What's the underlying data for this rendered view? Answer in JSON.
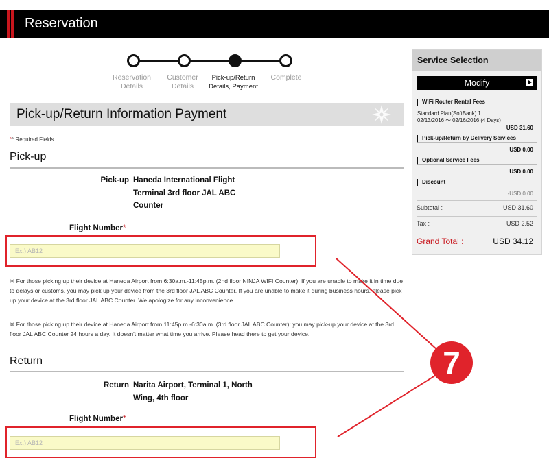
{
  "header": {
    "title": "Reservation"
  },
  "steps": [
    {
      "label_line1": "Reservation",
      "label_line2": "Details",
      "active": false
    },
    {
      "label_line1": "Customer",
      "label_line2": "Details",
      "active": false
    },
    {
      "label_line1": "Pick-up/Return",
      "label_line2": "Details, Payment",
      "active": true
    },
    {
      "label_line1": "Complete",
      "label_line2": "",
      "active": false
    }
  ],
  "section": {
    "title": "Pick-up/Return Information Payment"
  },
  "required_note": {
    "star": "*",
    "text": "* Required Fields"
  },
  "pickup": {
    "heading": "Pick-up",
    "location_label": "Pick-up",
    "location_line1": "Haneda International Flight",
    "location_line2": "Terminal 3rd floor JAL ABC",
    "location_line3": "Counter",
    "flight_label": "Flight Number",
    "flight_required": "*",
    "flight_placeholder": "Ex.) AB12",
    "flight_value": "",
    "note1": "※ For those picking up their device at Haneda Airport from 6:30a.m.-11:45p.m. (2nd floor NINJA WIFI Counter): If you are unable to make it in time due to delays or customs, you may pick up your device from the 3rd floor JAL ABC Counter. If you are unable to make it during business hours, please pick up your device at the 3rd floor JAL ABC Counter. We apologize for any inconvenience.",
    "note2": "※ For those picking up their device at Haneda Airport from 11:45p.m.-6:30a.m. (3rd floor JAL ABC Counter): you may pick-up your device at the 3rd floor JAL ABC Counter 24 hours a day. It doesn't matter what time you arrive. Please head there to get your device."
  },
  "return": {
    "heading": "Return",
    "location_label": "Return",
    "location_line1": "Narita Airport, Terminal 1, North",
    "location_line2": "Wing, 4th floor",
    "flight_label": "Flight Number",
    "flight_required": "*",
    "flight_placeholder": "Ex.) AB12",
    "flight_value": ""
  },
  "annotation": {
    "marker": "7",
    "color": "#e0232b"
  },
  "sidebar": {
    "title": "Service Selection",
    "modify_label": "Modify",
    "wifi": {
      "heading": "WiFi Router Rental Fees",
      "plan": "Standard Plan(SoftBank) 1",
      "dates": "02/13/2016 ～ 02/16/2016 (4 Days)",
      "amount": "USD 31.60"
    },
    "delivery": {
      "heading": "Pick-up/Return by Delivery Services",
      "amount": "USD 0.00"
    },
    "optional": {
      "heading": "Optional Service Fees",
      "amount": "USD 0.00"
    },
    "discount": {
      "heading": "Discount",
      "amount": "-USD 0.00"
    },
    "subtotal_label": "Subtotal :",
    "subtotal": "USD 31.60",
    "tax_label": "Tax :",
    "tax": "USD 2.52",
    "grand_label": "Grand Total :",
    "grand": "USD 34.12"
  },
  "colors": {
    "brand_red": "#c8161d",
    "header_bg": "#000000",
    "input_bg": "#fafac8"
  }
}
